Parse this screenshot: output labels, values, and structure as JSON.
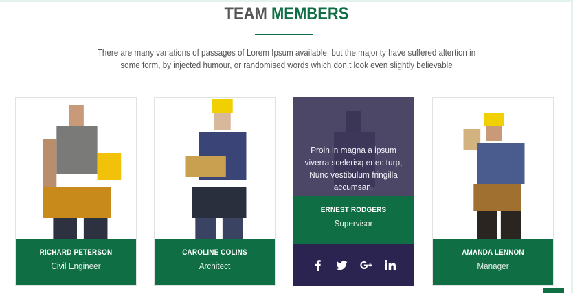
{
  "section": {
    "title_plain": "TEAM ",
    "title_accent": "MEMBERS",
    "intro": "There are many variations of passages of Lorem Ipsum available, but the majority have suffered altertion in some form, by injected humour, or randomised words which don,t look even slightly believable"
  },
  "team": [
    {
      "name": "RICHARD PETERSON",
      "role": "Civil Engineer"
    },
    {
      "name": "CAROLINE COLINS",
      "role": "Architect"
    },
    {
      "name": "ERNEST RODGERS",
      "role": "Supervisor",
      "bio": "Proin in magna a ipsum viverra scelerisq enec turp, Nunc vestibulum fringilla accumsan."
    },
    {
      "name": "AMANDA LENNON",
      "role": "Manager"
    }
  ],
  "social": [
    "facebook-icon",
    "twitter-icon",
    "google-plus-icon",
    "linkedin-icon"
  ],
  "colors": {
    "brand_green": "#0f6e43",
    "hover_purple": "#2b2451",
    "overlay_purple": "#4c4667"
  }
}
